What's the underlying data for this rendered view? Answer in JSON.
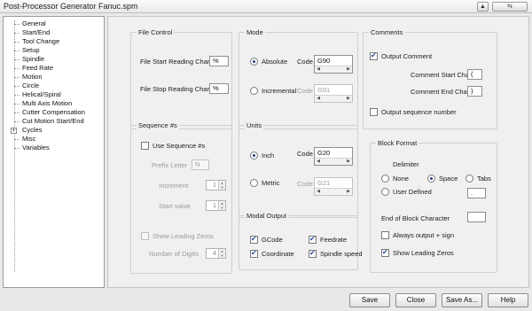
{
  "window": {
    "title": "Post-Processor Generator   Fanuc.spm",
    "controls": [
      "▲",
      "⇆"
    ]
  },
  "tree": {
    "items": [
      {
        "label": "General",
        "expandable": false
      },
      {
        "label": "Start/End",
        "expandable": false
      },
      {
        "label": "Tool Change",
        "expandable": false
      },
      {
        "label": "Setup",
        "expandable": false
      },
      {
        "label": "Spindle",
        "expandable": false
      },
      {
        "label": "Feed Rate",
        "expandable": false
      },
      {
        "label": "Motion",
        "expandable": false
      },
      {
        "label": "Circle",
        "expandable": false
      },
      {
        "label": "Helical/Spiral",
        "expandable": false
      },
      {
        "label": "Multi Axis Motion",
        "expandable": false
      },
      {
        "label": "Cutter Compensation",
        "expandable": false
      },
      {
        "label": "Cut Motion Start/End",
        "expandable": false
      },
      {
        "label": "Cycles",
        "expandable": true
      },
      {
        "label": "Misc",
        "expandable": false
      },
      {
        "label": "Variables",
        "expandable": false
      }
    ]
  },
  "file_control": {
    "title": "File Control",
    "start_label": "File Start Reading Char",
    "start_value": "%",
    "stop_label": "File Stop Reading Char",
    "stop_value": "%"
  },
  "mode": {
    "title": "Mode",
    "absolute_label": "Absolute",
    "absolute_code_label": "Code",
    "absolute_code": "G90",
    "incremental_label": "Incremental",
    "incremental_code_label": "Code",
    "incremental_code": "G91",
    "selected": "Absolute"
  },
  "comments": {
    "title": "Comments",
    "output_comment_label": "Output Comment",
    "output_comment_checked": true,
    "start_char_label": "Comment Start Char",
    "start_char": "(",
    "end_char_label": "Comment End Char",
    "end_char": ")",
    "seq_number_label": "Output sequence number",
    "seq_number_checked": false
  },
  "sequence": {
    "title": "Sequence #s",
    "use_label": "Use Sequence #s",
    "use_checked": false,
    "prefix_label": "Prefix Letter",
    "prefix_value": "N",
    "increment_label": "Increment",
    "increment_value": "1",
    "start_label": "Start value",
    "start_value": "1",
    "leading_zeros_label": "Show Leading Zeros",
    "leading_zeros_checked": false,
    "digits_label": "Number of Digits",
    "digits_value": "4"
  },
  "units": {
    "title": "Units",
    "inch_label": "Inch",
    "inch_code_label": "Code",
    "inch_code": "G20",
    "metric_label": "Metric",
    "metric_code_label": "Code",
    "metric_code": "G21",
    "selected": "Inch"
  },
  "modal_output": {
    "title": "Modal Output",
    "gcode_label": "GCode",
    "gcode_checked": true,
    "feedrate_label": "Feedrate",
    "feedrate_checked": true,
    "coordinate_label": "Coordinate",
    "coordinate_checked": true,
    "spindle_label": "Spindle speed",
    "spindle_checked": true
  },
  "block_format": {
    "title": "Block Format",
    "delimiter_label": "Delimiter",
    "none_label": "None",
    "space_label": "Space",
    "tabs_label": "Tabs",
    "user_defined_label": "User Defined",
    "user_defined_value": ".",
    "selected_delimiter": "Space",
    "end_block_label": "End of Block Character",
    "end_block_value": "",
    "always_sign_label": "Always output + sign",
    "always_sign_checked": false,
    "leading_zeros_label": "Show Leading Zeros",
    "leading_zeros_checked": true
  },
  "buttons": {
    "save": "Save",
    "close": "Close",
    "save_as": "Save As...",
    "help": "Help"
  }
}
